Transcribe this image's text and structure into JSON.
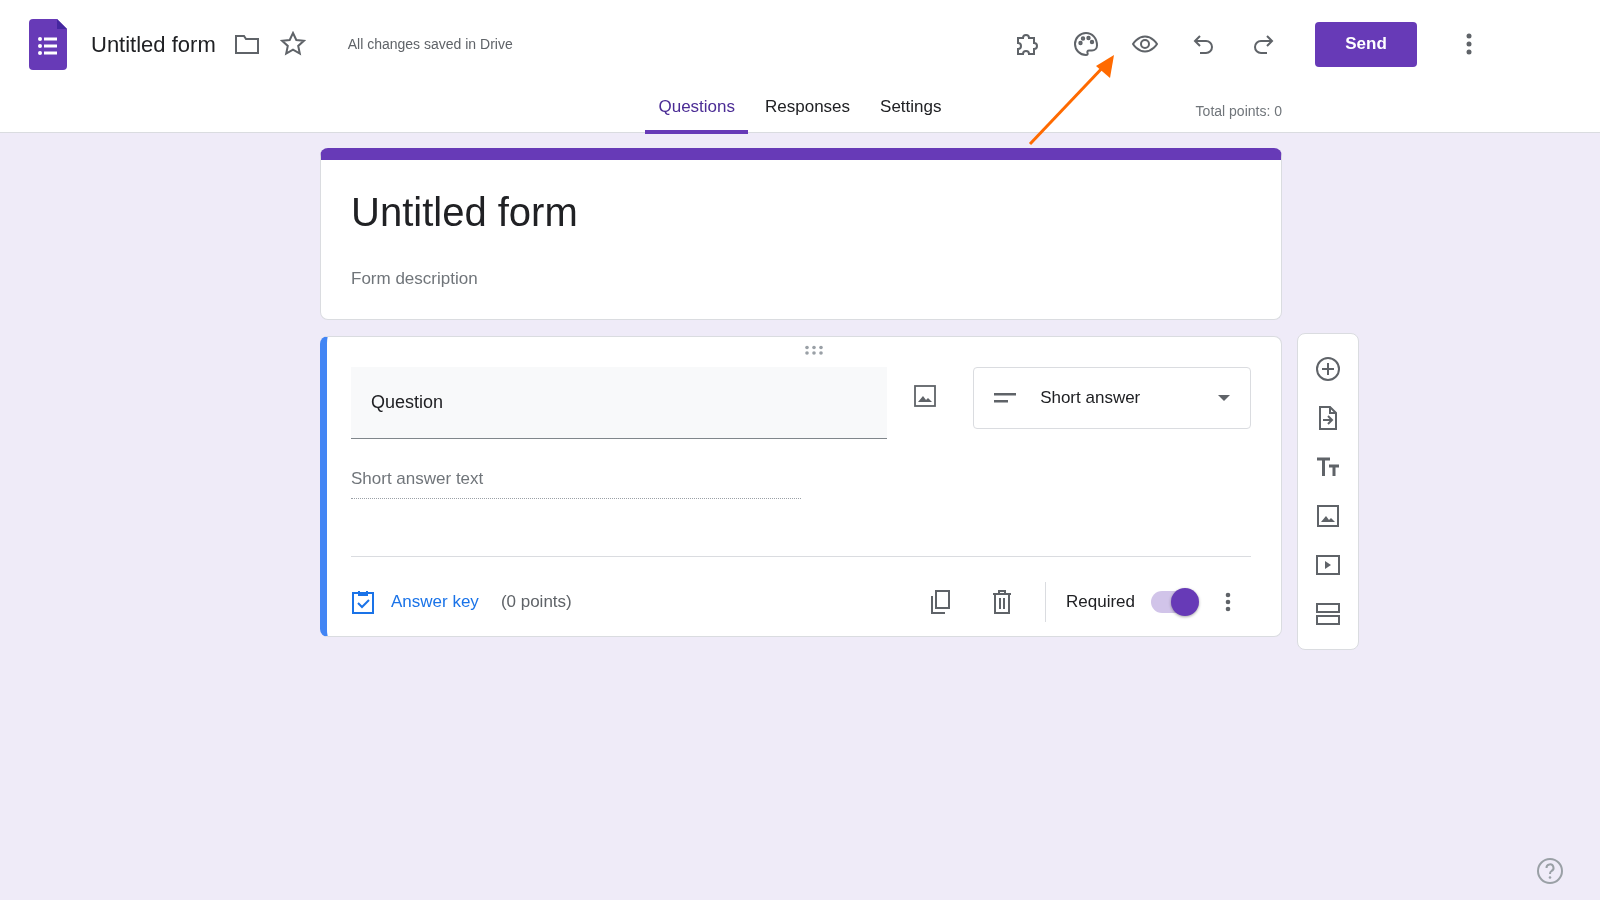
{
  "header": {
    "title": "Untitled form",
    "save_status": "All changes saved in Drive",
    "send_label": "Send"
  },
  "tabs": [
    {
      "label": "Questions",
      "selected": true
    },
    {
      "label": "Responses",
      "selected": false
    },
    {
      "label": "Settings",
      "selected": false
    }
  ],
  "total_points": "Total points: 0",
  "form": {
    "title": "Untitled form",
    "description_placeholder": "Form description"
  },
  "question": {
    "title": "Question",
    "type": "Short answer",
    "answer_placeholder": "Short answer text",
    "answer_key": "Answer key",
    "points": "(0 points)",
    "required_label": "Required",
    "required": true
  }
}
